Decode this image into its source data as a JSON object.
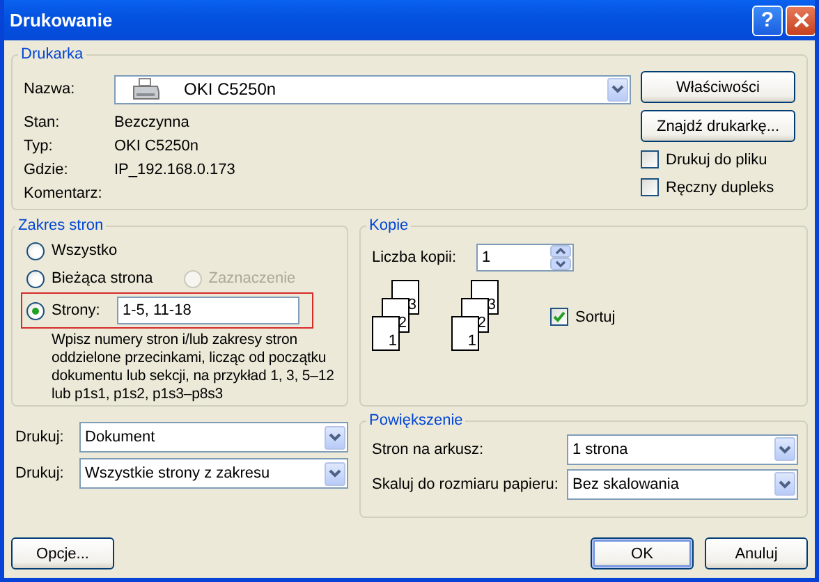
{
  "window": {
    "title": "Drukowanie",
    "help_label": "?"
  },
  "printer": {
    "title": "Drukarka",
    "name_label": "Nazwa:",
    "name_value": "OKI C5250n",
    "info": [
      {
        "label": "Stan:",
        "value": "Bezczynna"
      },
      {
        "label": "Typ:",
        "value": "OKI C5250n"
      },
      {
        "label": "Gdzie:",
        "value": "IP_192.168.0.173"
      },
      {
        "label": "Komentarz:"
      }
    ],
    "buttons": [
      "Właściwości",
      "Znajdź drukarkę..."
    ],
    "checkboxes": [
      {
        "label": "Drukuj do pliku",
        "checked": false
      },
      {
        "label": "Ręczny dupleks",
        "checked": false
      }
    ]
  },
  "range": {
    "title": "Zakres stron",
    "options": [
      {
        "label": "Wszystko",
        "selected": false,
        "disabled": false
      },
      {
        "label": "Bieżąca strona",
        "selected": false,
        "disabled": false
      },
      {
        "label": "Zaznaczenie",
        "selected": false,
        "disabled": true
      },
      {
        "label": "Strony:",
        "selected": true,
        "disabled": false
      }
    ],
    "pages_value": "1-5, 11-18",
    "pages_row_highlighted": true,
    "hint": "Wpisz numery stron i/lub zakresy stron oddzielone przecinkami, licząc od początku dokumentu lub sekcji, na przykład 1, 3, 5–12 lub p1s1, p1s2, p1s3–p8s3"
  },
  "copies": {
    "title": "Kopie",
    "count_label": "Liczba kopii:",
    "count_value": "1",
    "stacks": [
      [
        "3",
        "2",
        "1"
      ],
      [
        "3",
        "2",
        "1"
      ]
    ],
    "collate": {
      "label": "Sortuj",
      "checked": true
    }
  },
  "print_what": [
    {
      "label": "Drukuj:",
      "value": "Dokument"
    },
    {
      "label": "Drukuj:",
      "value": "Wszystkie strony z zakresu"
    }
  ],
  "zoom": {
    "title": "Powiększenie",
    "rows": [
      {
        "label": "Stron na arkusz:",
        "value": "1 strona"
      },
      {
        "label": "Skaluj do rozmiaru papieru:",
        "value": "Bez skalowania"
      }
    ]
  },
  "footer": {
    "left_buttons": [
      {
        "label": "Opcje...",
        "default": false
      }
    ],
    "right_buttons": [
      {
        "label": "OK",
        "default": true
      },
      {
        "label": "Anuluj",
        "default": false
      }
    ]
  }
}
